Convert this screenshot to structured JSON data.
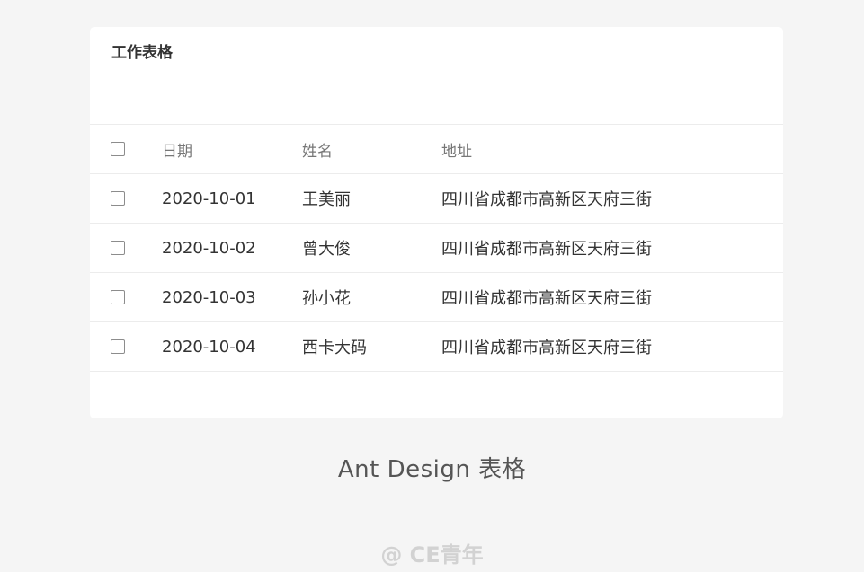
{
  "card": {
    "title": "工作表格"
  },
  "table": {
    "columns": [
      "日期",
      "姓名",
      "地址"
    ],
    "rows": [
      {
        "date": "2020-10-01",
        "name": "王美丽",
        "address": "四川省成都市高新区天府三街"
      },
      {
        "date": "2020-10-02",
        "name": "曾大俊",
        "address": "四川省成都市高新区天府三街"
      },
      {
        "date": "2020-10-03",
        "name": "孙小花",
        "address": "四川省成都市高新区天府三街"
      },
      {
        "date": "2020-10-04",
        "name": "西卡大码",
        "address": "四川省成都市高新区天府三街"
      }
    ]
  },
  "caption": "Ant Design 表格",
  "watermark": "@ CE青年"
}
